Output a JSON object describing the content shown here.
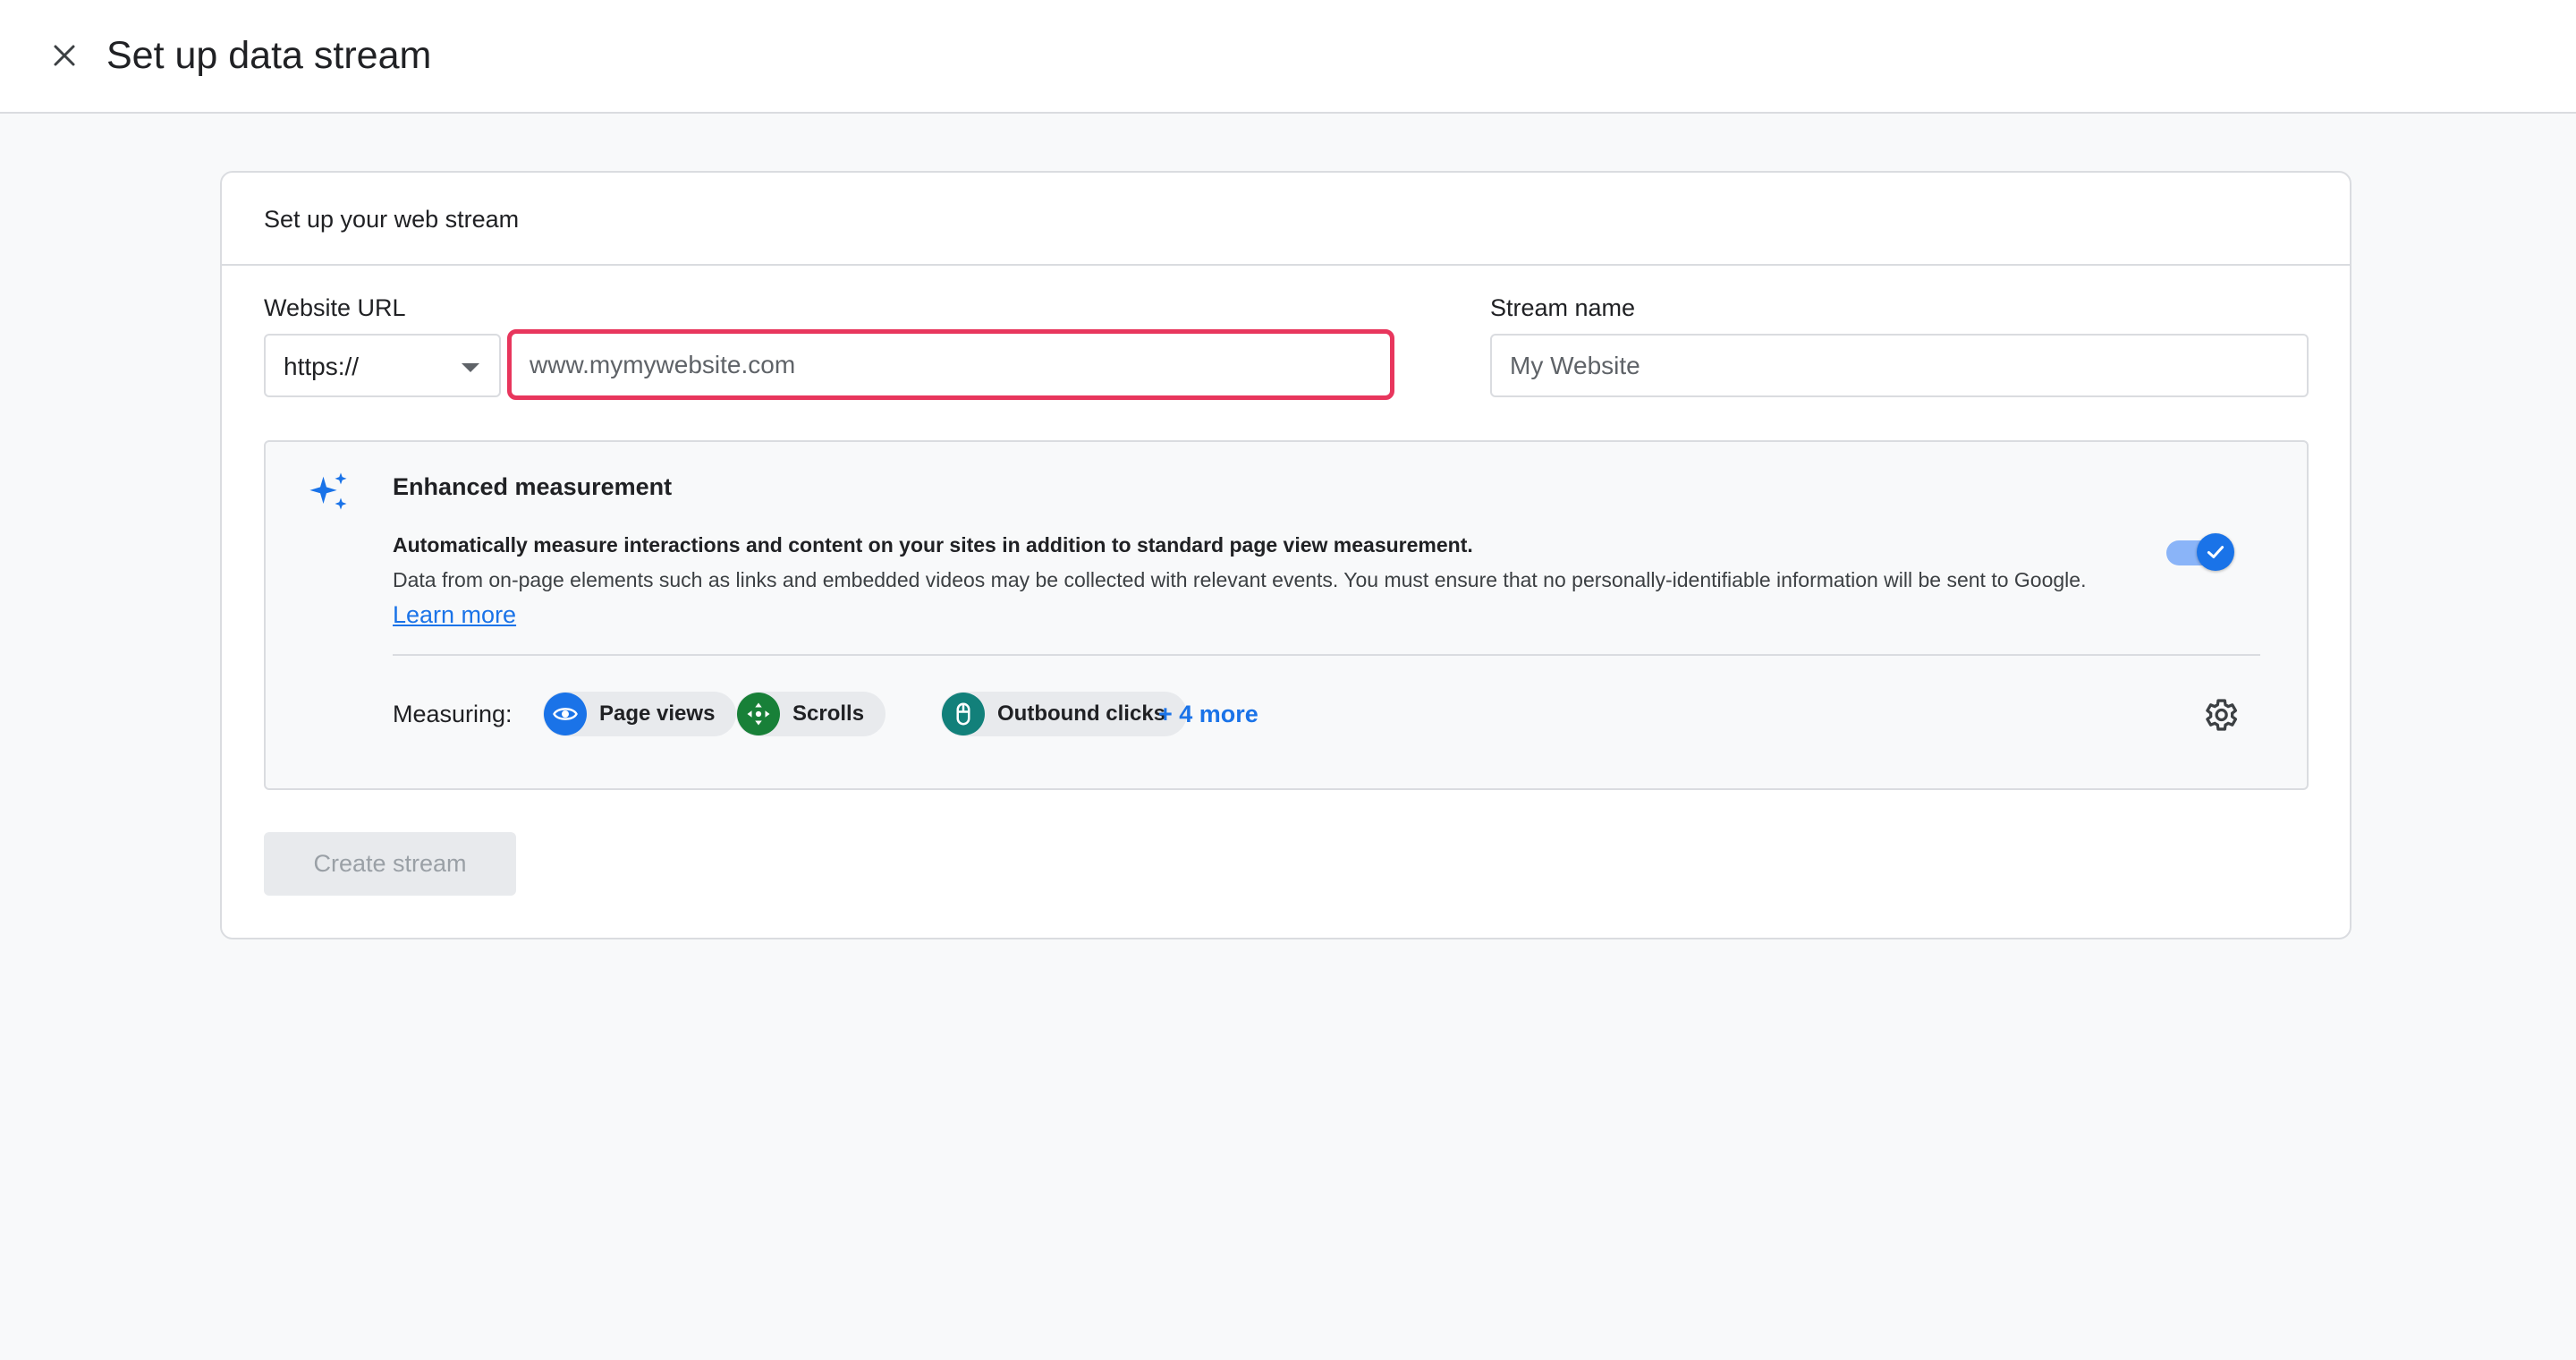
{
  "header": {
    "title": "Set up data stream",
    "close_icon": "close-icon"
  },
  "card": {
    "title": "Set up your web stream",
    "website_url": {
      "label": "Website URL",
      "protocol_selected": "https://",
      "placeholder": "www.mymywebsite.com"
    },
    "stream_name": {
      "label": "Stream name",
      "placeholder": "My Website"
    },
    "enhanced_measurement": {
      "title": "Enhanced measurement",
      "summary": "Automatically measure interactions and content on your sites in addition to standard page view measurement.",
      "description": "Data from on-page elements such as links and embedded videos may be collected with relevant events. You must ensure that no personally-identifiable information will be sent to Google.",
      "learn_more": "Learn more",
      "toggle_on": true,
      "measuring_label": "Measuring:",
      "chips": [
        {
          "label": "Page views",
          "icon": "eye-icon",
          "color": "#1a73e8"
        },
        {
          "label": "Scrolls",
          "icon": "move-arrows-icon",
          "color": "#188038"
        },
        {
          "label": "Outbound clicks",
          "icon": "mouse-icon",
          "color": "#12807a"
        }
      ],
      "more_link": "+ 4 more"
    },
    "create_button": "Create stream"
  },
  "colors": {
    "accent": "#1a73e8",
    "highlight_border": "#e8365d",
    "background": "#f8f9fa"
  }
}
